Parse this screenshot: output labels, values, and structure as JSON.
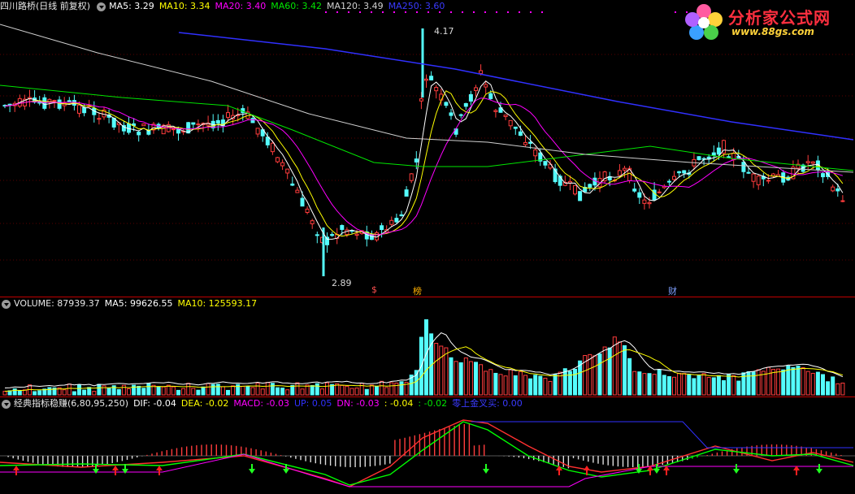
{
  "price_header": {
    "title": "四川路桥(日线 前复权)",
    "ma5": "MA5: 3.29",
    "ma10": "MA10: 3.34",
    "ma20": "MA20: 3.40",
    "ma60": "MA60: 3.42",
    "ma120": "MA120: 3.49",
    "ma250": "MA250: 3.60"
  },
  "volume_header": {
    "volume": "VOLUME: 87939.37",
    "ma5": "MA5: 99626.55",
    "ma10": "MA10: 125593.17"
  },
  "indicator_header": {
    "name": "经典指标稳赚(6,80,95,250)",
    "dif": "DIF: -0.04",
    "dea": "DEA: -0.02",
    "macd": "MACD: -0.03",
    "up": "UP: 0.05",
    "dn": "DN: -0.03",
    "v1": ": -0.04",
    "v2": ": -0.02",
    "cross": "零上金叉买: 0.00"
  },
  "price_labels": {
    "high": "4.17",
    "low": "2.89"
  },
  "markers": {
    "m1": "$",
    "m2": "榜",
    "m3": "财"
  },
  "logo": {
    "name": "分析家公式网",
    "url": "www.88gs.com"
  },
  "colors": {
    "up": "#ff3c3c",
    "down": "#54fcfc",
    "ma5": "#ffffff",
    "ma10": "#ffff00",
    "ma20": "#ff00ff",
    "ma60": "#00e600",
    "ma120": "#cfcfcf",
    "ma250": "#3030ff",
    "grid": "#8b0000"
  }
}
